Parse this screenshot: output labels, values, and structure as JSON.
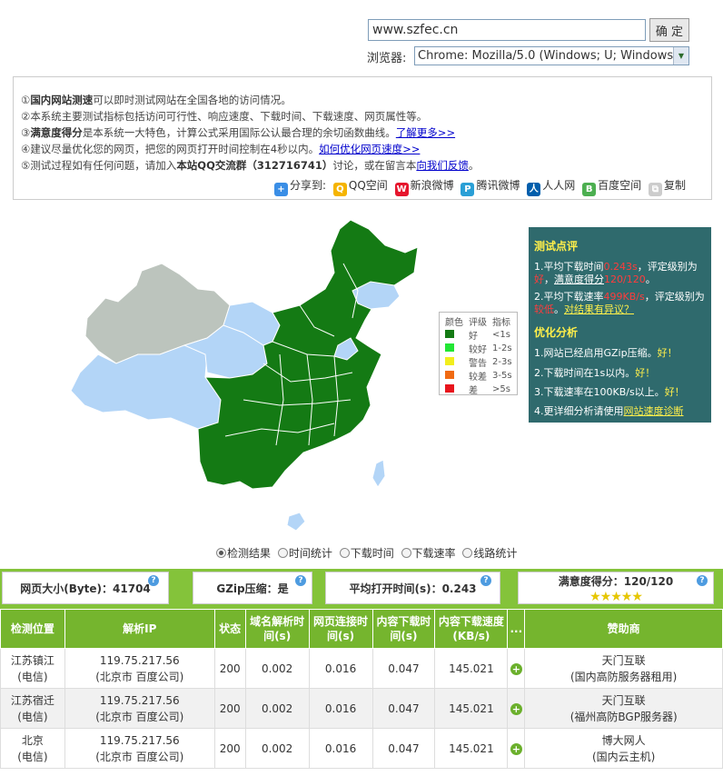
{
  "search": {
    "url_value": "www.szfec.cn",
    "go_label": "确 定"
  },
  "browser": {
    "label": "浏览器:",
    "selected": "Chrome: Mozilla/5.0 (Windows; U; Windows..."
  },
  "info": {
    "lines": [
      {
        "num": "①",
        "bold": "国内网站测速",
        "text": "可以即时测试网站在全国各地的访问情况。"
      },
      {
        "num": "②",
        "text": "本系统主要测试指标包括访问可行性、响应速度、下载时间、下载速度、网页属性等。"
      },
      {
        "num": "③",
        "bold": "满意度得分",
        "text": "是本系统一大特色，计算公式采用国际公认最合理的余切函数曲线。",
        "link": "了解更多>>"
      },
      {
        "num": "④",
        "text": "建议尽量优化您的网页，把您的网页打开时间控制在4秒以内。",
        "link": "如何优化网页速度>>"
      },
      {
        "num": "⑤",
        "text": "测试过程如有任何问题，请加入",
        "bold": "本站QQ交流群（312716741）",
        "text2": "讨论，或在留言本",
        "link": "向我们反馈",
        "text3": "。"
      }
    ]
  },
  "share": {
    "label": "分享到:",
    "items": [
      "QQ空间",
      "新浪微博",
      "腾讯微博",
      "人人网",
      "百度空间",
      "复制"
    ]
  },
  "legend": {
    "headers": [
      "颜色",
      "评级",
      "指标"
    ],
    "rows": [
      {
        "color": "#147a14",
        "grade": "好",
        "range": "<1s"
      },
      {
        "color": "#22e634",
        "grade": "较好",
        "range": "1-2s"
      },
      {
        "color": "#f2ee1c",
        "grade": "警告",
        "range": "2-3s"
      },
      {
        "color": "#f06a12",
        "grade": "较差",
        "range": "3-5s"
      },
      {
        "color": "#e8141c",
        "grade": "差",
        "range": ">5s"
      }
    ]
  },
  "panel": {
    "title1": "测试点评",
    "c1_a": "1.平均下载时间",
    "c1_val": "0.243s",
    "c1_b": "，评定级别为",
    "c1_grade": "好",
    "c1_c": "，",
    "c1_d": "满意度得分",
    "c1_score": "120/120",
    "c1_e": "。",
    "c2_a": "2.平均下载速率",
    "c2_val": "499KB/s",
    "c2_b": "，评定级别为",
    "c2_grade": "较低",
    "c2_c": "。",
    "c2_link": "对结果有异议？",
    "title2": "优化分析",
    "o1": "1.网站已经启用GZip压缩。",
    "o1_good": "好！",
    "o2": "2.下载时间在1s以内。",
    "o2_good": "好！",
    "o3": "3.下载速率在100KB/s以上。",
    "o3_good": "好！",
    "o4": "4.更详细分析请使用",
    "o4_link": "网站速度诊断"
  },
  "tabs": [
    "检测结果",
    "时间统计",
    "下载时间",
    "下载速率",
    "线路统计"
  ],
  "summary": {
    "page_size": "网页大小(Byte)：41704",
    "gzip": "GZip压缩：是",
    "avg_open": "平均打开时间(s)：0.243",
    "score": "满意度得分：120/120",
    "stars": "★★★★★"
  },
  "table": {
    "headers": [
      "检测位置",
      "解析IP",
      "状态",
      "域名解析时间(s)",
      "网页连接时间(s)",
      "内容下载时间(s)",
      "内容下载速度(KB/s)",
      "...",
      "赞助商"
    ],
    "rows": [
      {
        "loc1": "江苏镇江",
        "loc2": "(电信)",
        "ip1": "119.75.217.56",
        "ip2": "(北京市 百度公司)",
        "status": "200",
        "dns": "0.002",
        "conn": "0.016",
        "dl": "0.047",
        "speed": "145.021",
        "sp1": "天门互联",
        "sp2": "(国内高防服务器租用)"
      },
      {
        "loc1": "江苏宿迁",
        "loc2": "(电信)",
        "ip1": "119.75.217.56",
        "ip2": "(北京市 百度公司)",
        "status": "200",
        "dns": "0.002",
        "conn": "0.016",
        "dl": "0.047",
        "speed": "145.021",
        "sp1": "天门互联",
        "sp2": "(福州高防BGP服务器)"
      },
      {
        "loc1": "北京",
        "loc2": "(电信)",
        "ip1": "119.75.217.56",
        "ip2": "(北京市 百度公司)",
        "status": "200",
        "dns": "0.002",
        "conn": "0.016",
        "dl": "0.047",
        "speed": "145.021",
        "sp1": "博大网人",
        "sp2": "(国内云主机)"
      }
    ]
  },
  "colors": {
    "good": "#147a14",
    "none": "#b3d5f7",
    "nodata": "#bcc4bd",
    "header_green": "#75b52e",
    "panel": "#2f6a6d"
  }
}
